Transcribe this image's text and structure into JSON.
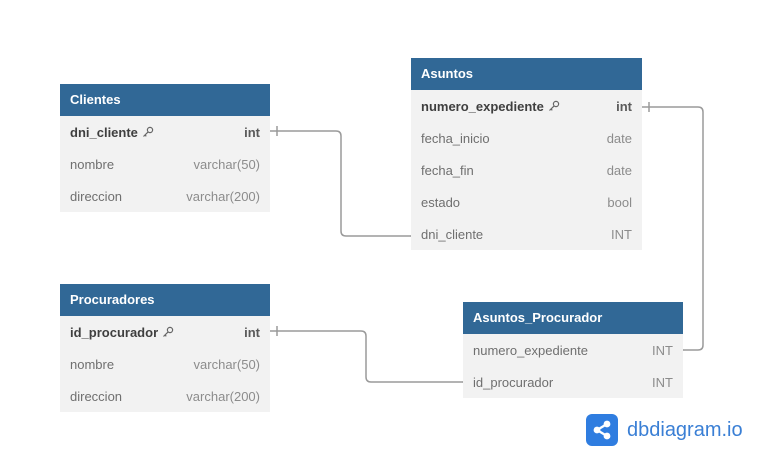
{
  "tables": [
    {
      "name": "Clientes",
      "columns": [
        {
          "name": "dni_cliente",
          "type": "int",
          "pk": true
        },
        {
          "name": "nombre",
          "type": "varchar(50)",
          "pk": false
        },
        {
          "name": "direccion",
          "type": "varchar(200)",
          "pk": false
        }
      ]
    },
    {
      "name": "Asuntos",
      "columns": [
        {
          "name": "numero_expediente",
          "type": "int",
          "pk": true
        },
        {
          "name": "fecha_inicio",
          "type": "date",
          "pk": false
        },
        {
          "name": "fecha_fin",
          "type": "date",
          "pk": false
        },
        {
          "name": "estado",
          "type": "bool",
          "pk": false
        },
        {
          "name": "dni_cliente",
          "type": "INT",
          "pk": false
        }
      ]
    },
    {
      "name": "Procuradores",
      "columns": [
        {
          "name": "id_procurador",
          "type": "int",
          "pk": true
        },
        {
          "name": "nombre",
          "type": "varchar(50)",
          "pk": false
        },
        {
          "name": "direccion",
          "type": "varchar(200)",
          "pk": false
        }
      ]
    },
    {
      "name": "Asuntos_Procurador",
      "columns": [
        {
          "name": "numero_expediente",
          "type": "INT",
          "pk": false
        },
        {
          "name": "id_procurador",
          "type": "INT",
          "pk": false
        }
      ]
    }
  ],
  "relationships": [
    {
      "from_table": "Clientes",
      "from_column": "dni_cliente",
      "to_table": "Asuntos",
      "to_column": "dni_cliente",
      "from_end": "one",
      "to_end": "many"
    },
    {
      "from_table": "Asuntos",
      "from_column": "numero_expediente",
      "to_table": "Asuntos_Procurador",
      "to_column": "numero_expediente",
      "from_end": "one",
      "to_end": "many"
    },
    {
      "from_table": "Procuradores",
      "from_column": "id_procurador",
      "to_table": "Asuntos_Procurador",
      "to_column": "id_procurador",
      "from_end": "one",
      "to_end": "many"
    }
  ],
  "brand": {
    "text": "dbdiagram.io",
    "logo_icon": "share-nodes-icon"
  },
  "colors": {
    "header": "#316896",
    "body": "#f2f2f2",
    "connector": "#9a9a9a",
    "brand": "#2f7de0"
  }
}
